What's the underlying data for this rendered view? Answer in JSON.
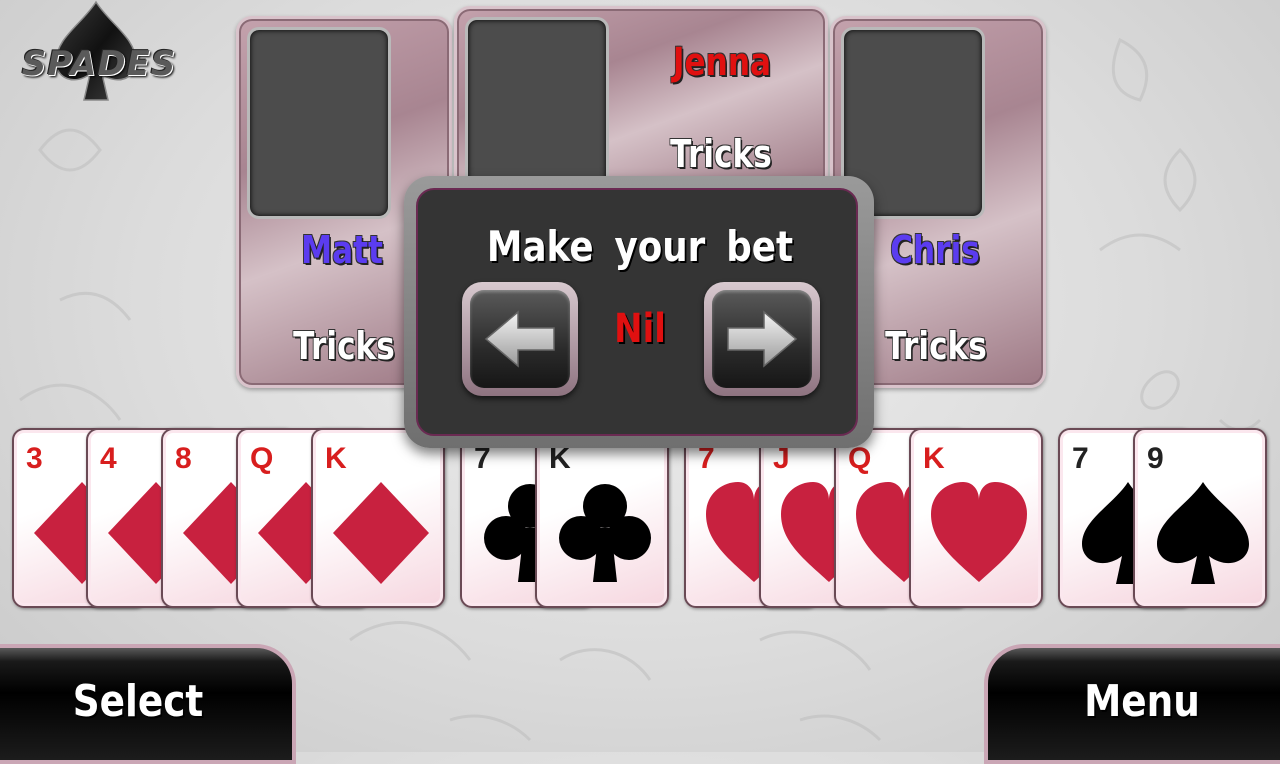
{
  "game": {
    "logo_text": "SPADES"
  },
  "dialog": {
    "title": "Make your bet",
    "bet_value": "Nil"
  },
  "players": {
    "west": {
      "name": "Matt",
      "tricks_label": "Tricks",
      "name_color": "#5b3cf0"
    },
    "north": {
      "name": "Jenna",
      "tricks_label": "Tricks",
      "name_color": "#e01010"
    },
    "east": {
      "name": "Chris",
      "tricks_label": "Tricks",
      "name_color": "#5b3cf0"
    }
  },
  "hand": [
    {
      "rank": "3",
      "suit": "diamonds"
    },
    {
      "rank": "4",
      "suit": "diamonds"
    },
    {
      "rank": "8",
      "suit": "diamonds"
    },
    {
      "rank": "Q",
      "suit": "diamonds"
    },
    {
      "rank": "K",
      "suit": "diamonds"
    },
    {
      "rank": "7",
      "suit": "clubs"
    },
    {
      "rank": "K",
      "suit": "clubs"
    },
    {
      "rank": "7",
      "suit": "hearts"
    },
    {
      "rank": "J",
      "suit": "hearts"
    },
    {
      "rank": "Q",
      "suit": "hearts"
    },
    {
      "rank": "K",
      "suit": "hearts"
    },
    {
      "rank": "7",
      "suit": "spades"
    },
    {
      "rank": "9",
      "suit": "spades"
    }
  ],
  "buttons": {
    "select": "Select",
    "menu": "Menu"
  },
  "colors": {
    "red_suit": "#c8213f",
    "black_suit": "#000000",
    "accent_pink": "#caa6b5"
  },
  "icons": {
    "prev": "left-arrow-icon",
    "next": "right-arrow-icon",
    "logo_spade": "spade-logo-icon"
  }
}
